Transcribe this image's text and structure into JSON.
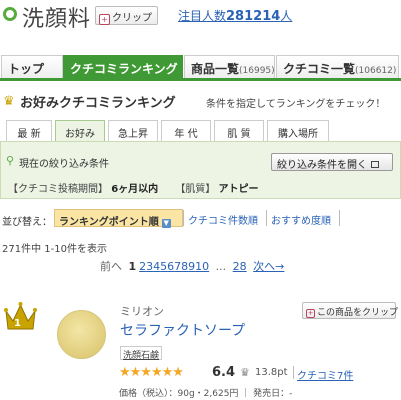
{
  "header": {
    "title": "洗顔料",
    "clip_label": "クリップ",
    "followers_label": "注目人数",
    "followers_count": "281214",
    "followers_suffix": "人"
  },
  "main_tabs": [
    {
      "label": "トップ",
      "count": ""
    },
    {
      "label": "クチコミランキング",
      "count": ""
    },
    {
      "label": "商品一覧",
      "count": "(16995)"
    },
    {
      "label": "クチコミ一覧",
      "count": "(106612)"
    }
  ],
  "ranking": {
    "title": "お好みクチコミランキング",
    "description": "条件を指定してランキングをチェック！"
  },
  "sub_tabs": [
    "最 新",
    "お好み",
    "急上昇",
    "年 代",
    "肌 質",
    "購入場所"
  ],
  "filter": {
    "title": "現在の絞り込み条件",
    "open_button": "絞り込み条件を開く",
    "period_label": "【クチコミ投稿期間】",
    "period_value": "6ヶ月以内",
    "skin_label": "【肌質】",
    "skin_value": "アトピー"
  },
  "sort": {
    "label": "並び替え：",
    "selected": "ランキングポイント順",
    "options": [
      "クチコミ件数順",
      "おすすめ度順"
    ]
  },
  "result_text": "271件中 1-10件を表示",
  "pager": {
    "prev": "前へ",
    "current": "1",
    "pages": [
      "2",
      "3",
      "4",
      "5",
      "6",
      "7",
      "8",
      "9",
      "10"
    ],
    "ellipsis": "...",
    "last": "28",
    "next": "次へ→"
  },
  "item": {
    "rank": "1",
    "brand": "ミリオン",
    "name": "セラファクトソープ",
    "clip_label": "この商品をクリップ",
    "category": "洗顔石鹸",
    "stars": "★★★★★★",
    "score": "6.4",
    "points": "13.8pt",
    "review_link": "クチコミ7件",
    "price": "価格（税込）：90g・2,625円 ｜ 発売日：-"
  },
  "colors": {
    "accent_green": "#3f9a36",
    "link_blue": "#2a63b6",
    "filter_bg": "#edf4e4",
    "sort_bg": "#fbe5a4",
    "star": "#f5a623"
  }
}
